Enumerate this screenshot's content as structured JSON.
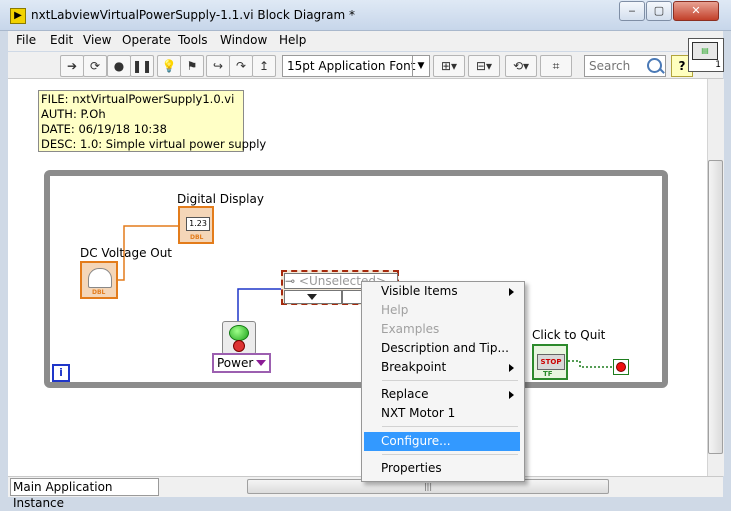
{
  "window": {
    "title": "nxtLabviewVirtualPowerSupply-1.1.vi Block Diagram *",
    "controls": {
      "minimize": "‒",
      "maximize": "▢",
      "close": "✕"
    }
  },
  "menubar": {
    "items": [
      "File",
      "Edit",
      "View",
      "Operate",
      "Tools",
      "Window",
      "Help"
    ]
  },
  "toolbar": {
    "font": "15pt Application Font",
    "search_placeholder": "Search",
    "help": "?",
    "connector_number": "1"
  },
  "diagram": {
    "comment": [
      "FILE: nxtVirtualPowerSupply1.0.vi",
      "AUTH: P.Oh",
      "DATE: 06/19/18 10:38",
      "DESC: 1.0: Simple virtual power supply"
    ],
    "digital_display": {
      "label": "Digital Display",
      "value": "1.23",
      "type": "DBL"
    },
    "dc_voltage": {
      "label": "DC Voltage Out",
      "type": "DBL"
    },
    "power": {
      "label": "Power"
    },
    "property_node": {
      "property": "<Unselected>"
    },
    "stop_button": {
      "label": "Click to Quit",
      "face": "STOP",
      "type": "TF"
    },
    "loop_iteration": "i"
  },
  "context_menu": {
    "items": [
      {
        "label": "Visible Items",
        "submenu": true,
        "disabled": false
      },
      {
        "label": "Help",
        "submenu": false,
        "disabled": true
      },
      {
        "label": "Examples",
        "submenu": false,
        "disabled": true
      },
      {
        "label": "Description and Tip...",
        "submenu": false,
        "disabled": false
      },
      {
        "label": "Breakpoint",
        "submenu": true,
        "disabled": false
      },
      {
        "label": "Replace",
        "submenu": true,
        "disabled": false
      },
      {
        "label": "NXT Motor 1",
        "submenu": false,
        "disabled": false
      },
      {
        "label": "Configure...",
        "submenu": false,
        "disabled": false,
        "highlighted": true
      },
      {
        "label": "Properties",
        "submenu": false,
        "disabled": false
      }
    ]
  },
  "statusbar": {
    "context": "Main Application Instance"
  }
}
